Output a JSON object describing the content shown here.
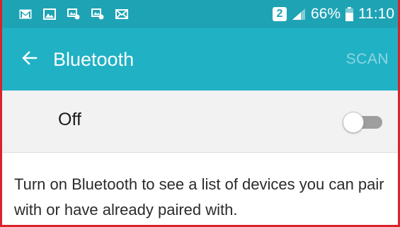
{
  "status_bar": {
    "notification_icons": [
      "gmail-icon",
      "gallery-icon",
      "screenshot-icon",
      "screenshot-icon",
      "email-icon"
    ],
    "sim_slot": "2",
    "battery_percent": "66%",
    "battery_level": 0.66,
    "time": "11:10"
  },
  "action_bar": {
    "back_icon": "arrow-left-icon",
    "title": "Bluetooth",
    "scan_label": "SCAN"
  },
  "toggle": {
    "label": "Off",
    "state": false
  },
  "info": {
    "text": "Turn on Bluetooth to see a list of devices you can pair with or have already paired with."
  },
  "colors": {
    "status_bar": "#1ea3b5",
    "action_bar": "#20b1c5",
    "scan_disabled": "#8ed6e0",
    "frame_border": "#d8232a"
  }
}
